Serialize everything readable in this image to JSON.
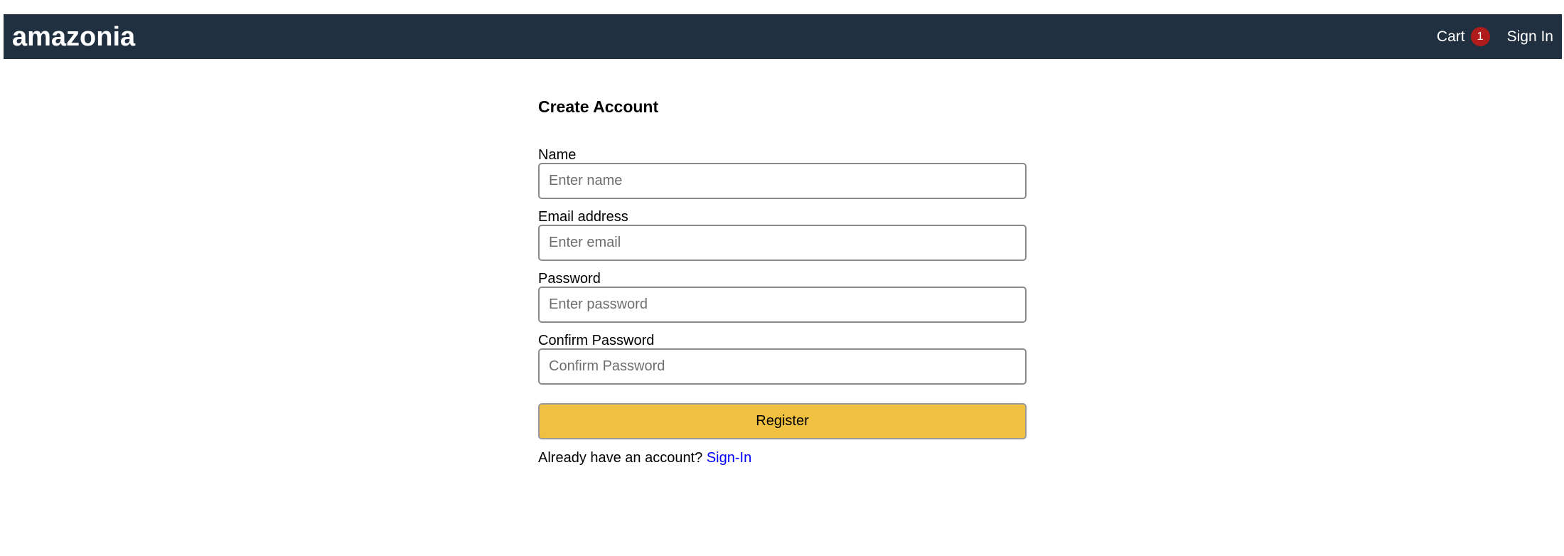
{
  "navbar": {
    "brand": "amazonia",
    "cart_label": "Cart",
    "cart_count": "1",
    "signin_label": "Sign In"
  },
  "form": {
    "title": "Create Account",
    "fields": [
      {
        "label": "Name",
        "placeholder": "Enter name"
      },
      {
        "label": "Email address",
        "placeholder": "Enter email"
      },
      {
        "label": "Password",
        "placeholder": "Enter password"
      },
      {
        "label": "Confirm Password",
        "placeholder": "Confirm Password"
      }
    ],
    "submit_label": "Register",
    "footer_text": "Already have an account?",
    "footer_link": "Sign-In"
  },
  "colors": {
    "navbar_bg": "#203040",
    "badge_bg": "#b01c1c",
    "button_bg": "#f0c040",
    "link": "#0000ff"
  }
}
